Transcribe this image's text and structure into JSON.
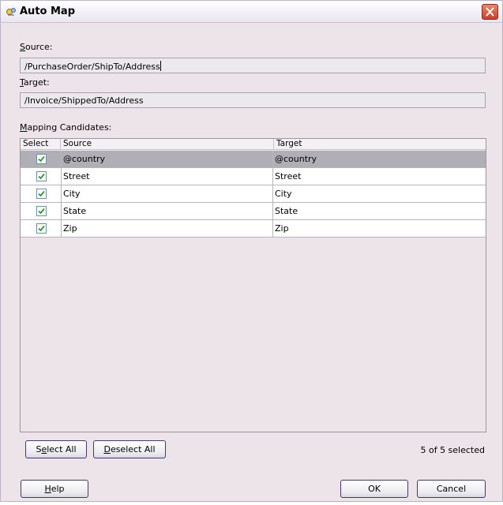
{
  "window": {
    "title": "Auto Map"
  },
  "source": {
    "label_first": "S",
    "label_rest": "ource:",
    "value": "/PurchaseOrder/ShipTo/Address"
  },
  "target": {
    "label_first": "T",
    "label_rest": "arget:",
    "value": "/Invoice/ShippedTo/Address"
  },
  "mapping": {
    "label_first": "M",
    "label_rest": "apping Candidates:",
    "columns": [
      "Select",
      "Source",
      "Target"
    ],
    "rows": [
      {
        "checked": true,
        "source": "@country",
        "target": "@country",
        "selected": true
      },
      {
        "checked": true,
        "source": "Street",
        "target": "Street",
        "selected": false
      },
      {
        "checked": true,
        "source": "City",
        "target": "City",
        "selected": false
      },
      {
        "checked": true,
        "source": "State",
        "target": "State",
        "selected": false
      },
      {
        "checked": true,
        "source": "Zip",
        "target": "Zip",
        "selected": false
      }
    ]
  },
  "buttons": {
    "select_all": {
      "pre": "S",
      "mn": "e",
      "post": "lect All"
    },
    "deselect_all": {
      "pre": "",
      "mn": "D",
      "post": "eselect All"
    },
    "help": {
      "pre": "",
      "mn": "H",
      "post": "elp"
    },
    "ok": "OK",
    "cancel": "Cancel"
  },
  "status": "5 of 5 selected"
}
